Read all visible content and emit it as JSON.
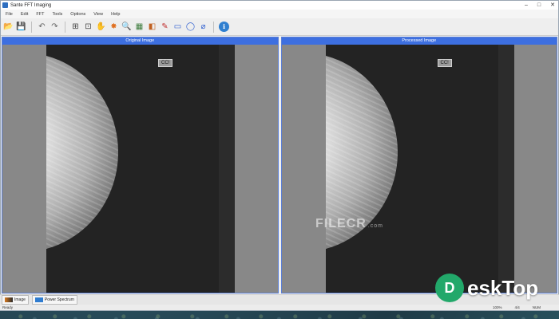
{
  "window": {
    "title": "Sante FFT Imaging",
    "controls": [
      "–",
      "□",
      "✕"
    ]
  },
  "menu": [
    "File",
    "Edit",
    "FFT",
    "Tools",
    "Options",
    "View",
    "Help"
  ],
  "toolbar": {
    "icons": [
      {
        "name": "open-icon",
        "glyph": "📂"
      },
      {
        "name": "save-icon",
        "glyph": "💾"
      },
      {
        "name": "undo-icon",
        "glyph": "↶"
      },
      {
        "name": "redo-icon",
        "glyph": "↷"
      },
      {
        "name": "fit-window-icon",
        "glyph": "⊞"
      },
      {
        "name": "actual-size-icon",
        "glyph": "⊡"
      },
      {
        "name": "hand-pan-icon",
        "glyph": "✋"
      },
      {
        "name": "brightness-icon",
        "glyph": "✸"
      },
      {
        "name": "zoom-icon",
        "glyph": "🔍"
      },
      {
        "name": "filter-icon",
        "glyph": "▦"
      },
      {
        "name": "compare-icon",
        "glyph": "◧"
      },
      {
        "name": "pencil-icon",
        "glyph": "✎"
      },
      {
        "name": "rectangle-icon",
        "glyph": "▭"
      },
      {
        "name": "ellipse-icon",
        "glyph": "◯"
      },
      {
        "name": "line-eraser-icon",
        "glyph": "⌀"
      },
      {
        "name": "info-icon",
        "glyph": "ℹ"
      }
    ]
  },
  "panels": {
    "original": {
      "title": "Original Image",
      "label": "CC!"
    },
    "processed": {
      "title": "Processed Image",
      "label": "CC!"
    }
  },
  "tabs": [
    {
      "label": "Image"
    },
    {
      "label": "Power Spectrum"
    }
  ],
  "status": {
    "left": "Ready",
    "right": [
      "100%",
      "4/4",
      "NUM"
    ]
  },
  "watermarks": {
    "filecr": "FILECR",
    "filecr_suffix": ".com",
    "brand": "eskTop",
    "brand_letter": "D"
  },
  "colors": {
    "panel_header": "#3d6fe0",
    "logo_green": "#22a86a"
  }
}
